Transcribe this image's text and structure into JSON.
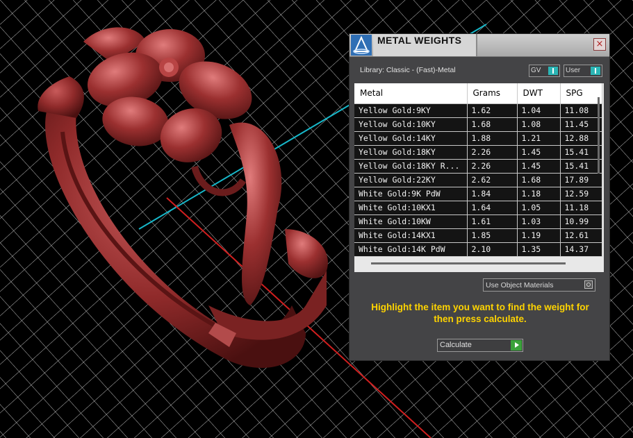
{
  "window": {
    "title": "METAL WEIGHTS",
    "close_label": "×",
    "icon_name": "app-logo-icon"
  },
  "library": {
    "label": "Library: Classic - (Fast)-Metal",
    "gv_label": "GV",
    "user_label": "User"
  },
  "table": {
    "headers": {
      "metal": "Metal",
      "grams": "Grams",
      "dwt": "DWT",
      "spg": "SPG"
    },
    "rows": [
      {
        "metal": "Yellow Gold:9KY",
        "grams": "1.62",
        "dwt": "1.04",
        "spg": "11.08"
      },
      {
        "metal": "Yellow Gold:10KY",
        "grams": "1.68",
        "dwt": "1.08",
        "spg": "11.45"
      },
      {
        "metal": "Yellow Gold:14KY",
        "grams": "1.88",
        "dwt": "1.21",
        "spg": "12.88"
      },
      {
        "metal": "Yellow Gold:18KY",
        "grams": "2.26",
        "dwt": "1.45",
        "spg": "15.41"
      },
      {
        "metal": "Yellow Gold:18KY R...",
        "grams": "2.26",
        "dwt": "1.45",
        "spg": "15.41"
      },
      {
        "metal": "Yellow Gold:22KY",
        "grams": "2.62",
        "dwt": "1.68",
        "spg": "17.89"
      },
      {
        "metal": "White Gold:9K PdW",
        "grams": "1.84",
        "dwt": "1.18",
        "spg": "12.59"
      },
      {
        "metal": "White Gold:10KX1",
        "grams": "1.64",
        "dwt": "1.05",
        "spg": "11.18"
      },
      {
        "metal": "White Gold:10KW",
        "grams": "1.61",
        "dwt": "1.03",
        "spg": "10.99"
      },
      {
        "metal": "White Gold:14KX1",
        "grams": "1.85",
        "dwt": "1.19",
        "spg": "12.61"
      },
      {
        "metal": "White Gold:14K PdW",
        "grams": "2.10",
        "dwt": "1.35",
        "spg": "14.37"
      }
    ]
  },
  "options": {
    "use_object_materials": "Use Object Materials"
  },
  "instructions": "Highlight the item you want to find the weight for then press calculate.",
  "calculate_label": "Calculate",
  "colors": {
    "ring": "#8f2a2a",
    "grid": "#bdbdbd",
    "axis_x": "#d11f1f",
    "axis_y": "#17b7c9",
    "instructions": "#ffd400",
    "toggle": "#2bb5b5",
    "play": "#3aa23a"
  }
}
